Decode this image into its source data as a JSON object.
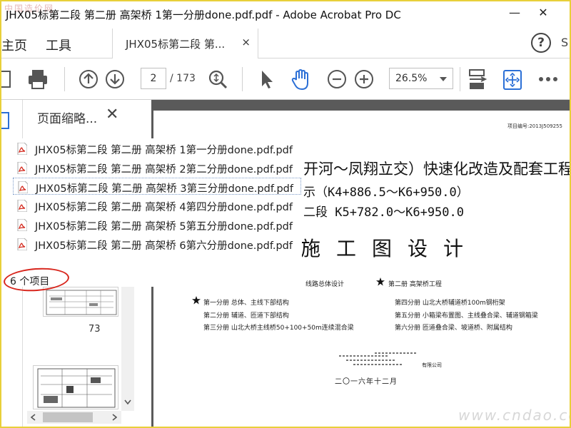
{
  "window": {
    "watermark": "中国造价网",
    "title": "JHX05标第二段 第二册 高架桥 1第一分册done.pdf.pdf - Adobe Acrobat Pro DC",
    "minimize": "—",
    "close": "✕"
  },
  "menubar": {
    "home_partial": "主页",
    "tools": "工具",
    "doc_tab": "JHX05标第二段 第...",
    "doc_tab_close": "×",
    "help": "?",
    "right_partial": "S"
  },
  "toolbar": {
    "current_page": "2",
    "page_total": "/ 173",
    "zoom": "26.5%"
  },
  "thumbnail_panel": {
    "title": "页面缩略...",
    "close": "✕",
    "thumb_page_number": "73"
  },
  "popup": {
    "items": [
      {
        "label": "JHX05标第二段 第二册 高架桥 1第一分册done.pdf.pdf"
      },
      {
        "label": "JHX05标第二段 第二册 高架桥 2第二分册done.pdf.pdf"
      },
      {
        "label": "JHX05标第二段 第二册 高架桥 3第三分册done.pdf.pdf"
      },
      {
        "label": "JHX05标第二段 第二册 高架桥 4第四分册done.pdf.pdf"
      },
      {
        "label": "JHX05标第二段 第二册 高架桥 5第五分册done.pdf.pdf"
      },
      {
        "label": "JHX05标第二段 第二册 高架桥 6第六分册done.pdf.pdf"
      }
    ],
    "selected_index": 2,
    "count_label": "6 个项目"
  },
  "document": {
    "project_no": "项目编号:2013J509255",
    "title_line1": "开河～凤翔立交）快速化改造及配套工程",
    "title_line2": "示（K4+886.5～K6+950.0）",
    "title_line3": "二段 K5+782.0～K6+950.0",
    "big_heading": "施工图设计",
    "route_design": "线路总体设计",
    "volume2": "第二册 高架桥工程",
    "sections_left": [
      "第一分册  总体、主线下部结构",
      "第二分册  辅道、匝道下部结构",
      "第三分册  山北大桥主线桥50+100+50m连续混合梁"
    ],
    "sections_right": [
      "第四分册  山北大桥辅道桥100m钢桁架",
      "第五分册  小箱梁布置图、主线叠合梁、辅道钢箱梁",
      "第六分册  匝道叠合梁、坡道桥、附属结构"
    ],
    "company_partial": "有限公司",
    "date": "二〇一六年十二月",
    "watermark": "www.cndao.com"
  },
  "colors": {
    "pdf_icon": "#d42b1f",
    "highlight_circle": "#d8261d",
    "doc_bg": "#5a5a5a",
    "frame_border": "#e8d03a"
  }
}
